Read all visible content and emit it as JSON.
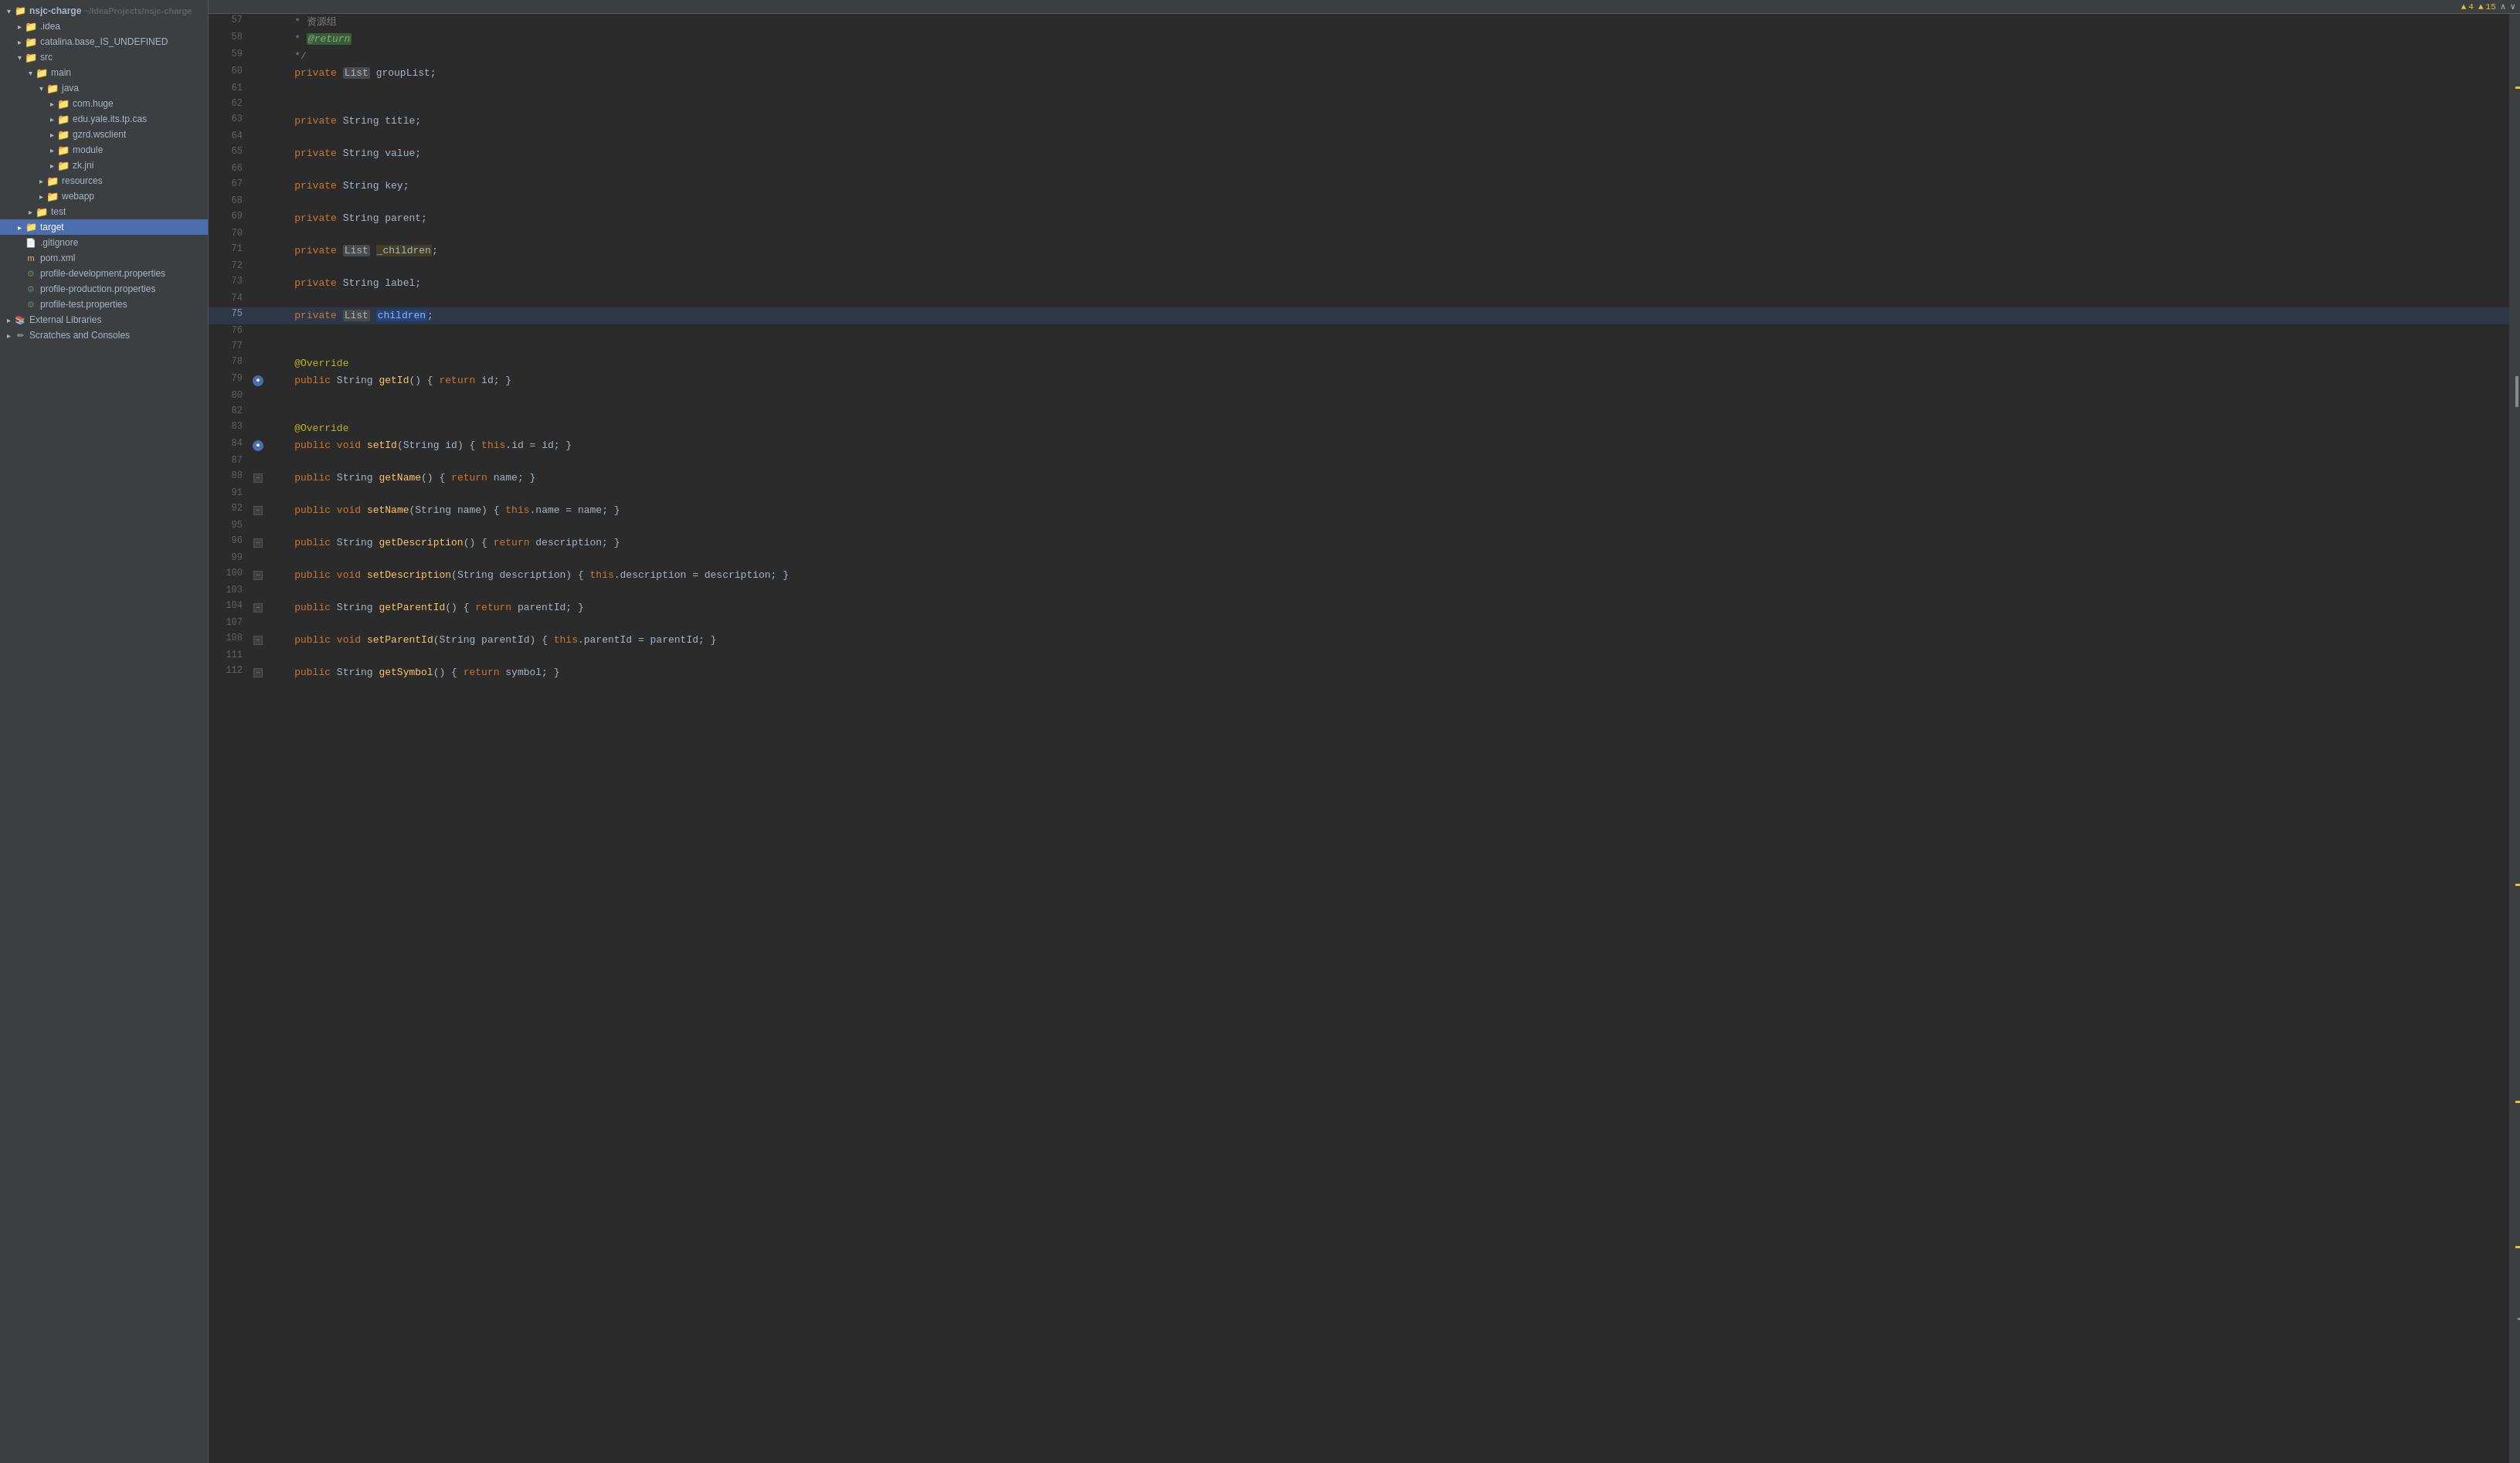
{
  "header": {
    "project": "nsjc-charge",
    "path": "~/IdeaProjects/nsjc-charge"
  },
  "sidebar": {
    "items": [
      {
        "id": "nsjc-charge",
        "label": "nsjc-charge",
        "indent": 1,
        "type": "root",
        "expanded": true,
        "selected": false
      },
      {
        "id": "idea",
        "label": ".idea",
        "indent": 2,
        "type": "folder-blue",
        "expanded": false,
        "selected": false
      },
      {
        "id": "catalina",
        "label": "catalina.base_IS_UNDEFINED",
        "indent": 2,
        "type": "folder",
        "expanded": false,
        "selected": false
      },
      {
        "id": "src",
        "label": "src",
        "indent": 2,
        "type": "folder",
        "expanded": true,
        "selected": false
      },
      {
        "id": "main",
        "label": "main",
        "indent": 3,
        "type": "folder",
        "expanded": true,
        "selected": false
      },
      {
        "id": "java",
        "label": "java",
        "indent": 4,
        "type": "folder-blue",
        "expanded": true,
        "selected": false
      },
      {
        "id": "com-huge",
        "label": "com.huge",
        "indent": 5,
        "type": "folder",
        "expanded": false,
        "selected": false
      },
      {
        "id": "edu-yale",
        "label": "edu.yale.its.tp.cas",
        "indent": 5,
        "type": "folder",
        "expanded": false,
        "selected": false
      },
      {
        "id": "gzrd-wsclient",
        "label": "gzrd.wsclient",
        "indent": 5,
        "type": "folder",
        "expanded": false,
        "selected": false
      },
      {
        "id": "module",
        "label": "module",
        "indent": 5,
        "type": "folder",
        "expanded": false,
        "selected": false
      },
      {
        "id": "zk-jni",
        "label": "zk.jni",
        "indent": 5,
        "type": "folder",
        "expanded": false,
        "selected": false
      },
      {
        "id": "resources",
        "label": "resources",
        "indent": 4,
        "type": "folder",
        "expanded": false,
        "selected": false
      },
      {
        "id": "webapp",
        "label": "webapp",
        "indent": 4,
        "type": "folder",
        "expanded": false,
        "selected": false
      },
      {
        "id": "test",
        "label": "test",
        "indent": 3,
        "type": "folder",
        "expanded": false,
        "selected": false
      },
      {
        "id": "target",
        "label": "target",
        "indent": 2,
        "type": "folder-orange",
        "expanded": false,
        "selected": true
      },
      {
        "id": "gitignore",
        "label": ".gitignore",
        "indent": 2,
        "type": "file",
        "expanded": false,
        "selected": false
      },
      {
        "id": "pom-xml",
        "label": "pom.xml",
        "indent": 2,
        "type": "xml",
        "expanded": false,
        "selected": false
      },
      {
        "id": "profile-dev",
        "label": "profile-development.properties",
        "indent": 2,
        "type": "prop",
        "expanded": false,
        "selected": false
      },
      {
        "id": "profile-prod",
        "label": "profile-production.properties",
        "indent": 2,
        "type": "prop",
        "expanded": false,
        "selected": false
      },
      {
        "id": "profile-test",
        "label": "profile-test.properties",
        "indent": 2,
        "type": "prop",
        "expanded": false,
        "selected": false
      },
      {
        "id": "external-libs",
        "label": "External Libraries",
        "indent": 1,
        "type": "external",
        "expanded": false,
        "selected": false
      },
      {
        "id": "scratches",
        "label": "Scratches and Consoles",
        "indent": 1,
        "type": "scratches",
        "expanded": false,
        "selected": false
      }
    ]
  },
  "topbar": {
    "warning_label": "▲ 4",
    "error_label": "▲ 15",
    "chevron_up": "∧",
    "chevron_down": "∨"
  },
  "code": {
    "lines": [
      {
        "num": 57,
        "gutter": "",
        "content": [
          {
            "t": "    ",
            "c": ""
          },
          {
            "t": "* ",
            "c": "comment"
          },
          {
            "t": "资源组",
            "c": "comment"
          }
        ]
      },
      {
        "num": 58,
        "gutter": "",
        "content": [
          {
            "t": "    ",
            "c": ""
          },
          {
            "t": "* ",
            "c": "comment"
          },
          {
            "t": "@return",
            "c": "comment-tag-hl"
          }
        ]
      },
      {
        "num": 59,
        "gutter": "",
        "content": [
          {
            "t": "    ",
            "c": ""
          },
          {
            "t": "*/",
            "c": "comment"
          }
        ]
      },
      {
        "num": 60,
        "gutter": "",
        "content": [
          {
            "t": "    private ",
            "c": ""
          },
          {
            "t": "List",
            "c": "type-hl"
          },
          {
            "t": " groupList;",
            "c": ""
          }
        ]
      },
      {
        "num": 61,
        "gutter": "",
        "content": []
      },
      {
        "num": 62,
        "gutter": "",
        "content": []
      },
      {
        "num": 63,
        "gutter": "",
        "content": [
          {
            "t": "    private ",
            "c": ""
          },
          {
            "t": "String",
            "c": ""
          },
          {
            "t": " title;",
            "c": ""
          }
        ]
      },
      {
        "num": 64,
        "gutter": "",
        "content": []
      },
      {
        "num": 65,
        "gutter": "",
        "content": [
          {
            "t": "    private ",
            "c": ""
          },
          {
            "t": "String",
            "c": ""
          },
          {
            "t": " value;",
            "c": ""
          }
        ]
      },
      {
        "num": 66,
        "gutter": "",
        "content": []
      },
      {
        "num": 67,
        "gutter": "",
        "content": [
          {
            "t": "    private ",
            "c": ""
          },
          {
            "t": "String",
            "c": ""
          },
          {
            "t": " key;",
            "c": ""
          }
        ]
      },
      {
        "num": 68,
        "gutter": "",
        "content": []
      },
      {
        "num": 69,
        "gutter": "",
        "content": [
          {
            "t": "    private ",
            "c": ""
          },
          {
            "t": "String",
            "c": ""
          },
          {
            "t": " parent;",
            "c": ""
          }
        ]
      },
      {
        "num": 70,
        "gutter": "",
        "content": []
      },
      {
        "num": 71,
        "gutter": "",
        "content": [
          {
            "t": "    private ",
            "c": ""
          },
          {
            "t": "List",
            "c": "type-hl"
          },
          {
            "t": " _children;",
            "c": "var-hl-special"
          }
        ]
      },
      {
        "num": 72,
        "gutter": "",
        "content": []
      },
      {
        "num": 73,
        "gutter": "",
        "content": [
          {
            "t": "    private ",
            "c": ""
          },
          {
            "t": "String",
            "c": ""
          },
          {
            "t": " label;",
            "c": ""
          }
        ]
      },
      {
        "num": 74,
        "gutter": "",
        "content": []
      },
      {
        "num": 75,
        "gutter": "",
        "content": [
          {
            "t": "    private ",
            "c": ""
          },
          {
            "t": "List",
            "c": "type-hl"
          },
          {
            "t": " ",
            "c": ""
          },
          {
            "t": "children",
            "c": "var-hl2"
          },
          {
            "t": ";",
            "c": ""
          }
        ],
        "highlighted": true
      },
      {
        "num": 76,
        "gutter": "",
        "content": []
      },
      {
        "num": 77,
        "gutter": "",
        "content": []
      },
      {
        "num": 78,
        "gutter": "",
        "content": [
          {
            "t": "    ",
            "c": ""
          },
          {
            "t": "@Override",
            "c": "annotation"
          }
        ]
      },
      {
        "num": 79,
        "gutter": "blue",
        "content": [
          {
            "t": "    public ",
            "c": ""
          },
          {
            "t": "String",
            "c": ""
          },
          {
            "t": " ",
            "c": ""
          },
          {
            "t": "getId",
            "c": "method"
          },
          {
            "t": "() { ",
            "c": ""
          },
          {
            "t": "return",
            "c": "kw"
          },
          {
            "t": " id; }",
            "c": ""
          }
        ]
      },
      {
        "num": 80,
        "gutter": "",
        "content": []
      },
      {
        "num": 82,
        "gutter": "",
        "content": []
      },
      {
        "num": 83,
        "gutter": "",
        "content": [
          {
            "t": "    ",
            "c": ""
          },
          {
            "t": "@Override",
            "c": "annotation"
          }
        ]
      },
      {
        "num": 84,
        "gutter": "blue",
        "content": [
          {
            "t": "    public ",
            "c": ""
          },
          {
            "t": "void",
            "c": "kw"
          },
          {
            "t": " ",
            "c": ""
          },
          {
            "t": "setId",
            "c": "method"
          },
          {
            "t": "(",
            "c": ""
          },
          {
            "t": "String",
            "c": ""
          },
          {
            "t": " id) { ",
            "c": ""
          },
          {
            "t": "this",
            "c": "kw"
          },
          {
            "t": ".id = id; }",
            "c": ""
          }
        ]
      },
      {
        "num": 87,
        "gutter": "",
        "content": []
      },
      {
        "num": 88,
        "gutter": "collapse",
        "content": [
          {
            "t": "    public ",
            "c": ""
          },
          {
            "t": "String",
            "c": ""
          },
          {
            "t": " ",
            "c": ""
          },
          {
            "t": "getName",
            "c": "method"
          },
          {
            "t": "() { ",
            "c": ""
          },
          {
            "t": "return",
            "c": "kw"
          },
          {
            "t": " name; }",
            "c": ""
          }
        ]
      },
      {
        "num": 91,
        "gutter": "",
        "content": []
      },
      {
        "num": 92,
        "gutter": "collapse",
        "content": [
          {
            "t": "    public ",
            "c": ""
          },
          {
            "t": "void",
            "c": "kw"
          },
          {
            "t": " ",
            "c": ""
          },
          {
            "t": "setName",
            "c": "method"
          },
          {
            "t": "(",
            "c": ""
          },
          {
            "t": "String",
            "c": ""
          },
          {
            "t": " name) { ",
            "c": ""
          },
          {
            "t": "this",
            "c": "kw"
          },
          {
            "t": ".name = name; }",
            "c": ""
          }
        ]
      },
      {
        "num": 95,
        "gutter": "",
        "content": []
      },
      {
        "num": 96,
        "gutter": "collapse",
        "content": [
          {
            "t": "    public ",
            "c": ""
          },
          {
            "t": "String",
            "c": ""
          },
          {
            "t": " ",
            "c": ""
          },
          {
            "t": "getDescription",
            "c": "method"
          },
          {
            "t": "() { ",
            "c": ""
          },
          {
            "t": "return",
            "c": "kw"
          },
          {
            "t": " description; }",
            "c": ""
          }
        ]
      },
      {
        "num": 99,
        "gutter": "",
        "content": []
      },
      {
        "num": 100,
        "gutter": "collapse",
        "content": [
          {
            "t": "    public ",
            "c": ""
          },
          {
            "t": "void",
            "c": "kw"
          },
          {
            "t": " ",
            "c": ""
          },
          {
            "t": "setDescription",
            "c": "method"
          },
          {
            "t": "(",
            "c": ""
          },
          {
            "t": "String",
            "c": ""
          },
          {
            "t": " description) { ",
            "c": ""
          },
          {
            "t": "this",
            "c": "kw"
          },
          {
            "t": ".description = description; }",
            "c": ""
          }
        ]
      },
      {
        "num": 103,
        "gutter": "",
        "content": []
      },
      {
        "num": 104,
        "gutter": "collapse",
        "content": [
          {
            "t": "    public ",
            "c": ""
          },
          {
            "t": "String",
            "c": ""
          },
          {
            "t": " ",
            "c": ""
          },
          {
            "t": "getParentId",
            "c": "method"
          },
          {
            "t": "() { ",
            "c": ""
          },
          {
            "t": "return",
            "c": "kw"
          },
          {
            "t": " parentId; }",
            "c": ""
          }
        ]
      },
      {
        "num": 107,
        "gutter": "",
        "content": []
      },
      {
        "num": 108,
        "gutter": "collapse",
        "content": [
          {
            "t": "    public ",
            "c": ""
          },
          {
            "t": "void",
            "c": "kw"
          },
          {
            "t": " ",
            "c": ""
          },
          {
            "t": "setParentId",
            "c": "method"
          },
          {
            "t": "(",
            "c": ""
          },
          {
            "t": "String",
            "c": ""
          },
          {
            "t": " parentId) { ",
            "c": ""
          },
          {
            "t": "this",
            "c": "kw"
          },
          {
            "t": ".parentId = parentId; }",
            "c": ""
          }
        ]
      },
      {
        "num": 111,
        "gutter": "",
        "content": []
      },
      {
        "num": 112,
        "gutter": "collapse",
        "content": [
          {
            "t": "    public ",
            "c": ""
          },
          {
            "t": "String",
            "c": ""
          },
          {
            "t": " ",
            "c": ""
          },
          {
            "t": "getSymbol",
            "c": "method"
          },
          {
            "t": "() { ",
            "c": ""
          },
          {
            "t": "return",
            "c": "kw"
          },
          {
            "t": " symbol; }",
            "c": ""
          }
        ]
      }
    ]
  }
}
